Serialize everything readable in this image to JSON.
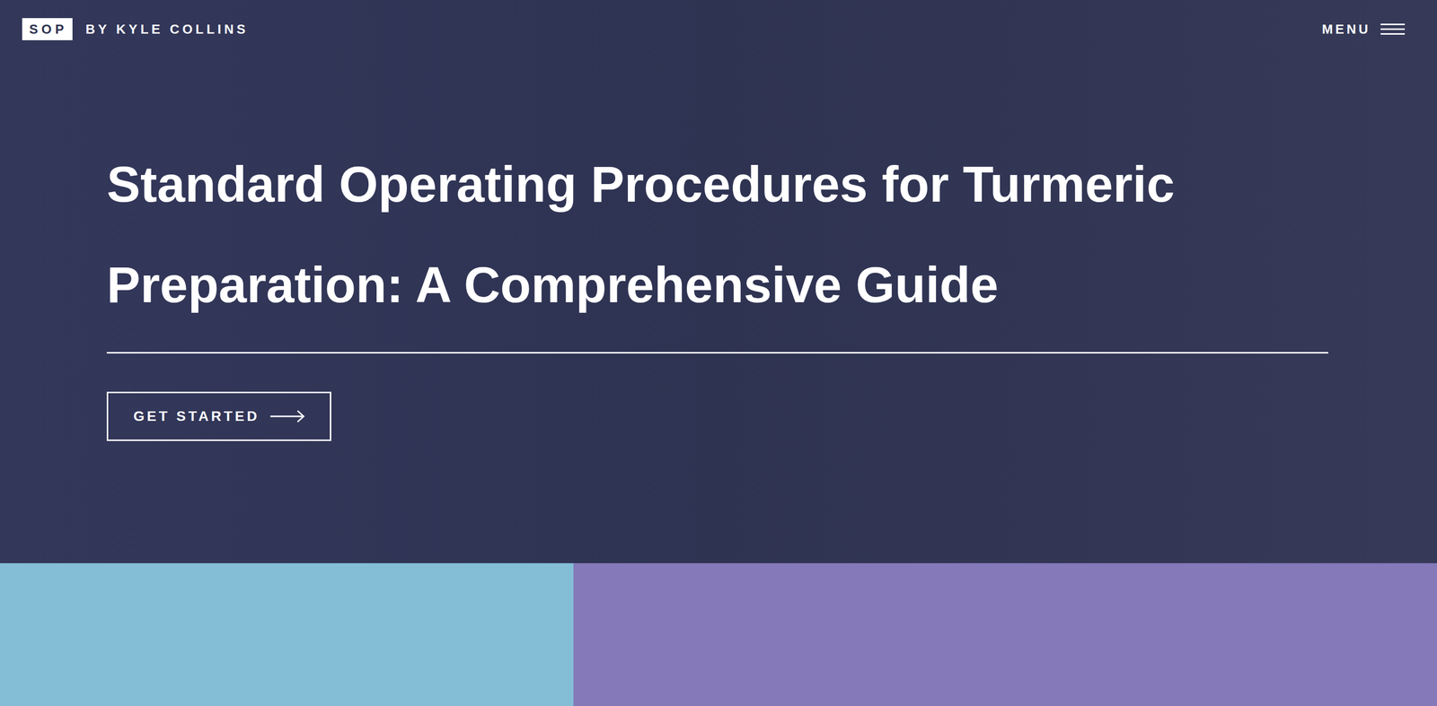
{
  "header": {
    "logo": "SOP",
    "brand": "BY KYLE COLLINS",
    "menu": "MENU"
  },
  "hero": {
    "title": "Standard Operating Procedures for Turmeric Preparation: A Comprehensive Guide",
    "button": "GET STARTED"
  }
}
